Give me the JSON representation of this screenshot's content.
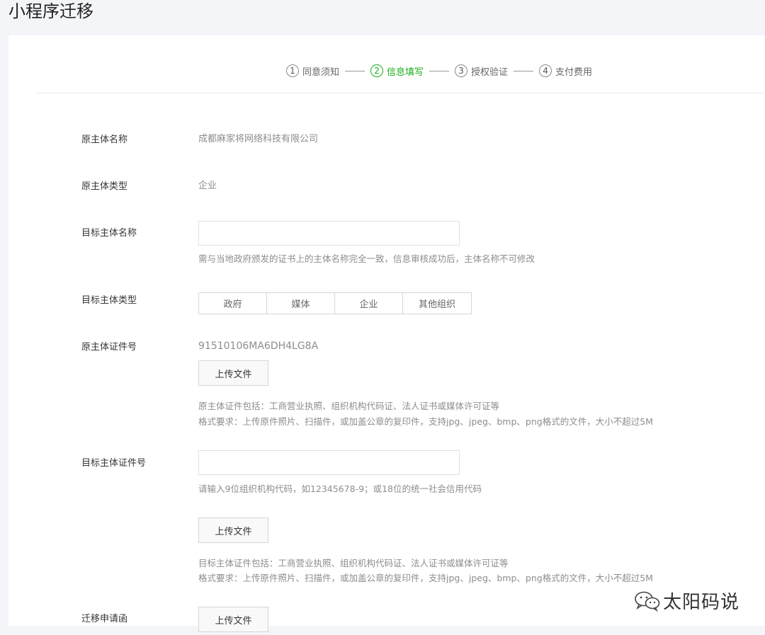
{
  "page": {
    "title": "小程序迁移"
  },
  "steps": [
    {
      "num": "1",
      "label": "同意须知",
      "active": false
    },
    {
      "num": "2",
      "label": "信息填写",
      "active": true
    },
    {
      "num": "3",
      "label": "授权验证",
      "active": false
    },
    {
      "num": "4",
      "label": "支付费用",
      "active": false
    }
  ],
  "form": {
    "orig_name_label": "原主体名称",
    "orig_name_value": "成都麻家将网络科技有限公司",
    "orig_type_label": "原主体类型",
    "orig_type_value": "企业",
    "target_name_label": "目标主体名称",
    "target_name_value": "",
    "target_name_hint": "需与当地政府颁发的证书上的主体名称完全一致，信息审核成功后，主体名称不可修改",
    "target_type_label": "目标主体类型",
    "target_type_options": [
      "政府",
      "媒体",
      "企业",
      "其他组织"
    ],
    "orig_cert_label": "原主体证件号",
    "orig_cert_value": "91510106MA6DH4LG8A",
    "upload_label": "上传文件",
    "orig_cert_hint1": "原主体证件包括：工商营业执照、组织机构代码证、法人证书或媒体许可证等",
    "orig_cert_hint2": "格式要求：上传原件照片、扫描件，或加盖公章的复印件，支持jpg、jpeg、bmp、png格式的文件，大小不超过5M",
    "target_cert_label": "目标主体证件号",
    "target_cert_value": "",
    "target_cert_input_hint": "请输入9位组织机构代码，如12345678-9；或18位的统一社会信用代码",
    "target_cert_hint1": "目标主体证件包括：工商营业执照、组织机构代码证、法人证书或媒体许可证等",
    "target_cert_hint2": "格式要求：上传原件照片、扫描件，或加盖公章的复印件，支持jpg、jpeg、bmp、png格式的文件，大小不超过5M",
    "migration_letter_label": "迁移申请函"
  },
  "watermark": {
    "text": "太阳码说",
    "icon": "wechat-icon"
  },
  "colors": {
    "accent": "#1aad19"
  }
}
